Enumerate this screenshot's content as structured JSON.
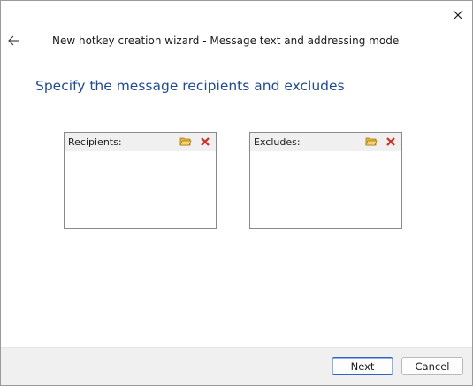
{
  "window": {
    "title": "New hotkey creation wizard - Message text and addressing mode",
    "close_icon": "close-icon",
    "back_icon": "arrow-left-icon"
  },
  "page": {
    "heading": "Specify the message recipients and excludes"
  },
  "recipients": {
    "label": "Recipients:",
    "icons": [
      "folder-open-icon",
      "delete-x-icon"
    ],
    "items": []
  },
  "excludes": {
    "label": "Excludes:",
    "icons": [
      "folder-open-icon",
      "delete-x-icon"
    ],
    "items": []
  },
  "footer": {
    "next_label": "Next",
    "cancel_label": "Cancel"
  },
  "colors": {
    "heading": "#1f4b99",
    "footer_bg": "#f0f0f0",
    "delete_icon": "#d42a1f",
    "folder_icon": "#e8b436"
  }
}
